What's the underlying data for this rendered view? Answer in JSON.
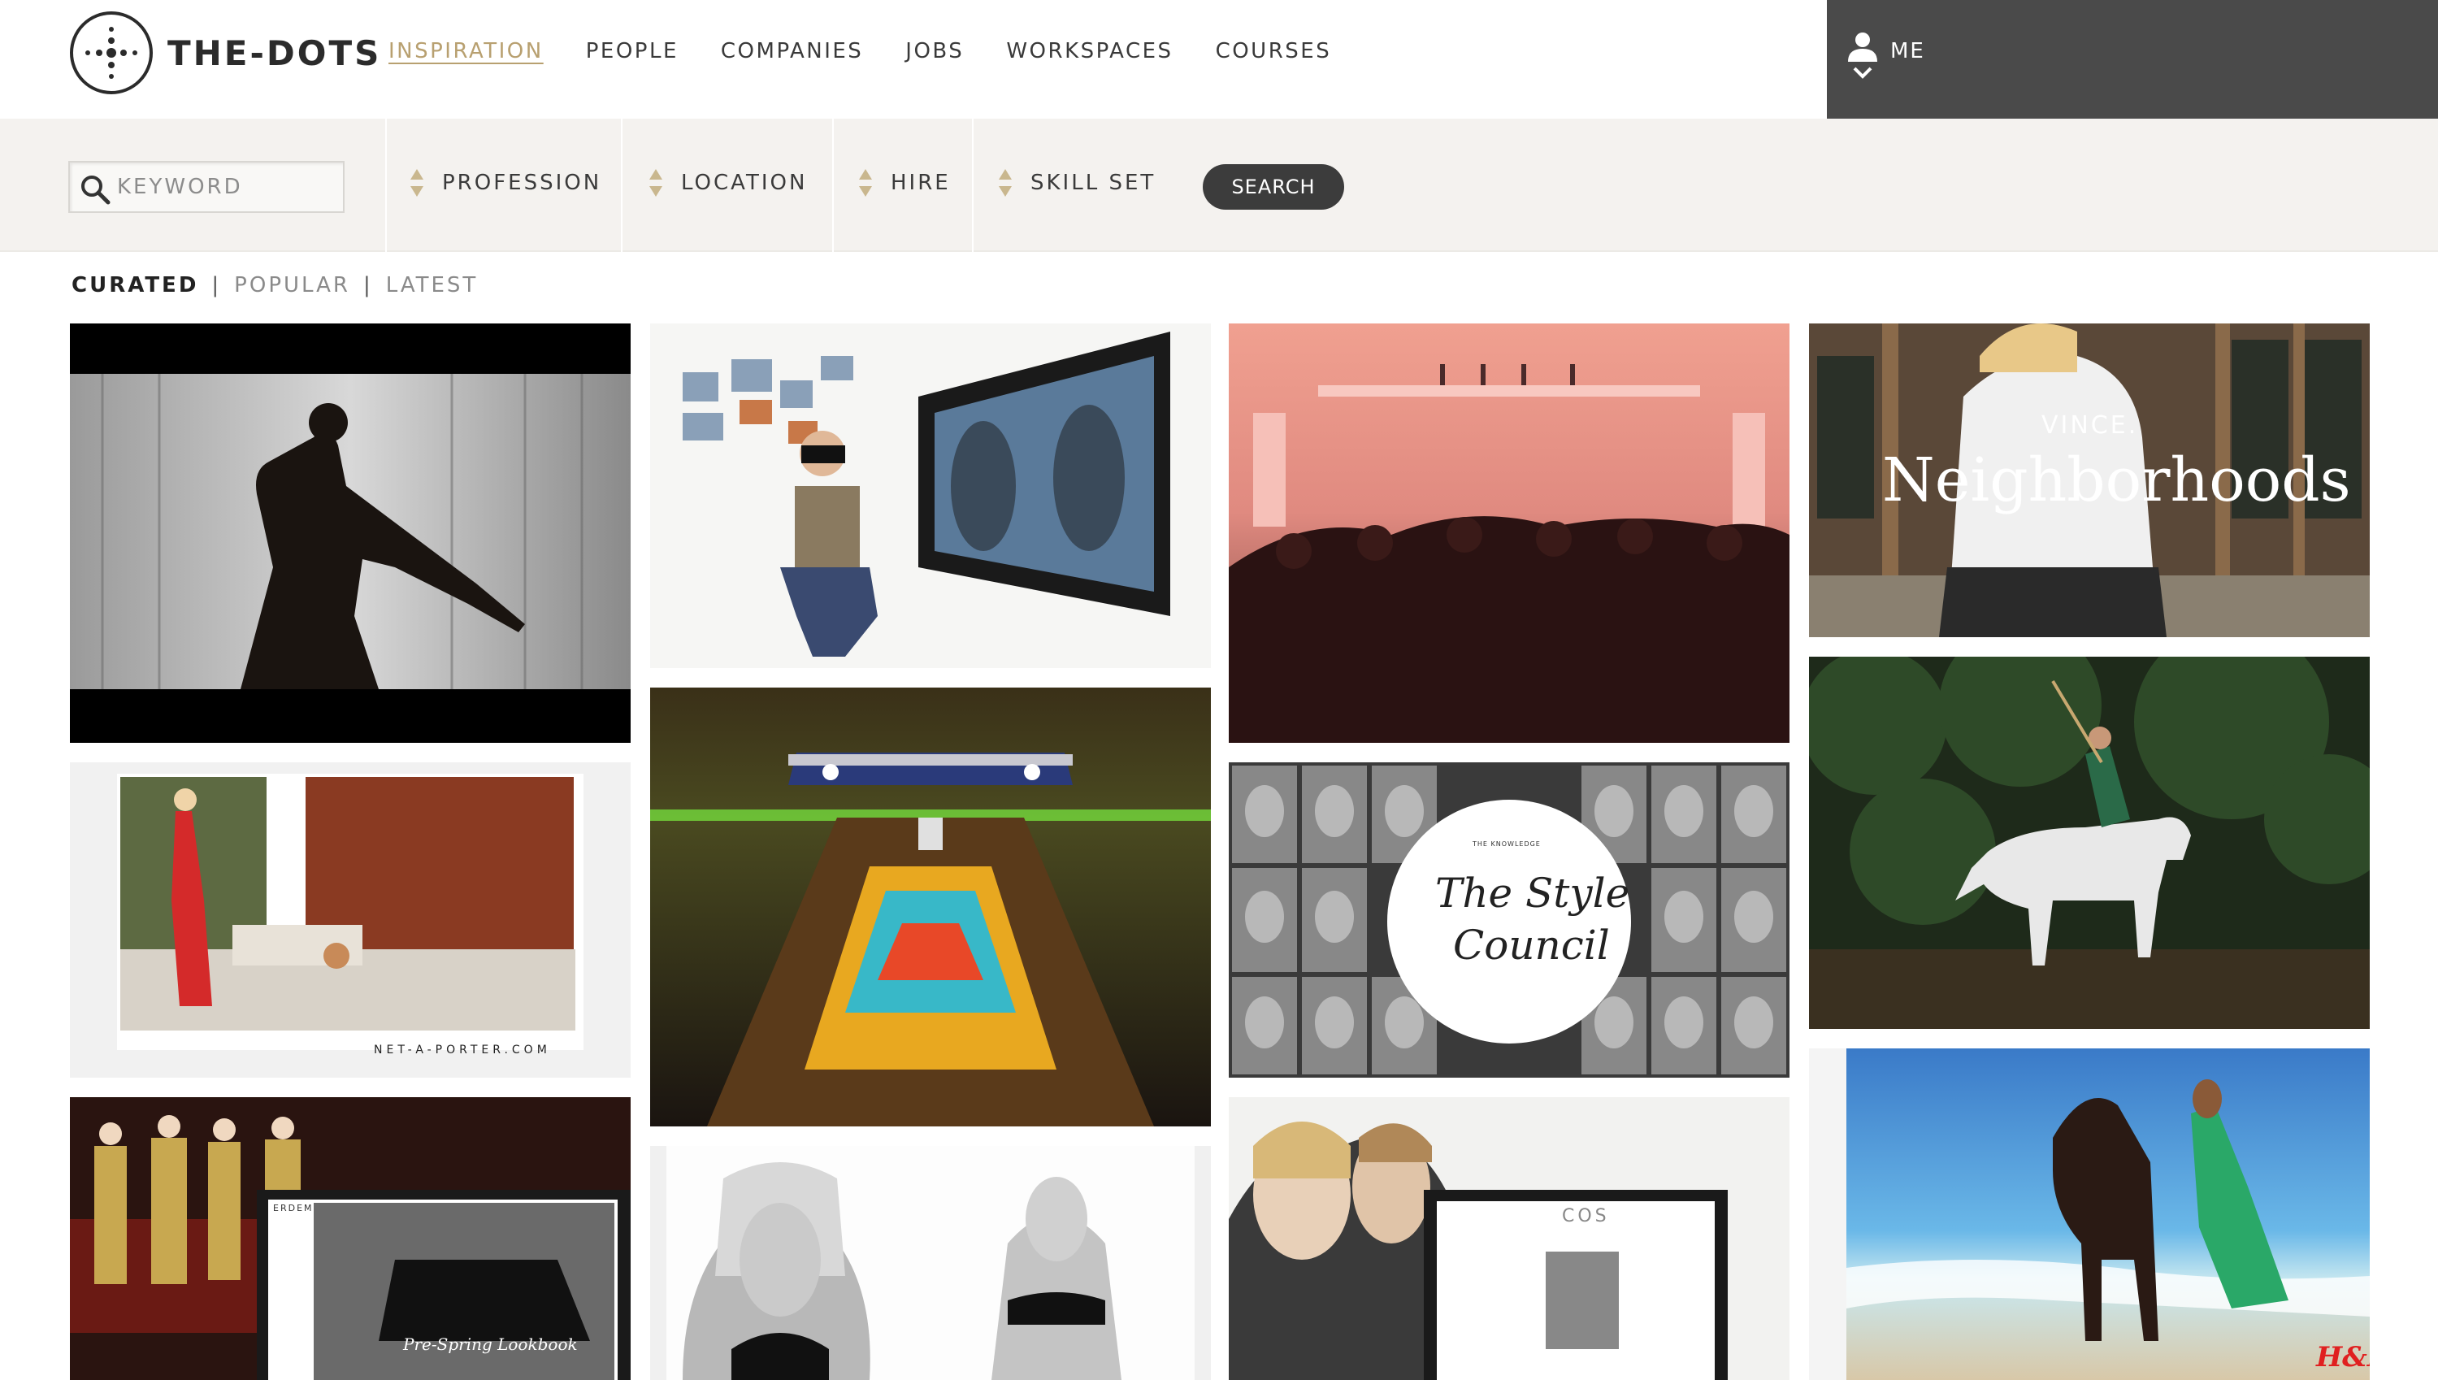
{
  "brand": {
    "name": "THE-DOTS"
  },
  "nav": [
    {
      "label": "INSPIRATION",
      "active": true
    },
    {
      "label": "PEOPLE"
    },
    {
      "label": "COMPANIES"
    },
    {
      "label": "JOBS"
    },
    {
      "label": "WORKSPACES"
    },
    {
      "label": "COURSES"
    }
  ],
  "user_menu": {
    "label": "ME"
  },
  "search": {
    "placeholder": "KEYWORD",
    "filters": [
      "PROFESSION",
      "LOCATION",
      "HIRE",
      "SKILL SET"
    ],
    "button_label": "SEARCH"
  },
  "tabs": [
    {
      "label": "CURATED",
      "active": true
    },
    {
      "label": "POPULAR"
    },
    {
      "label": "LATEST"
    }
  ],
  "tiles": {
    "net_a_porter_caption": "NET-A-PORTER.COM",
    "vince_brand": "VINCE.",
    "vince_title": "Neighborhoods",
    "style_council_kicker": "THE KNOWLEDGE",
    "style_council_title_1": "The Style",
    "style_council_title_2": "Council",
    "cos_brand": "COS",
    "hm_brand": "H&M",
    "erdem_brand": "ERDEM",
    "lookbook_text": "Pre-Spring Lookbook"
  },
  "colors": {
    "header_dark": "#4a4a4a",
    "accent_gold": "#b8a070",
    "filter_bg": "#f4f2ef"
  }
}
